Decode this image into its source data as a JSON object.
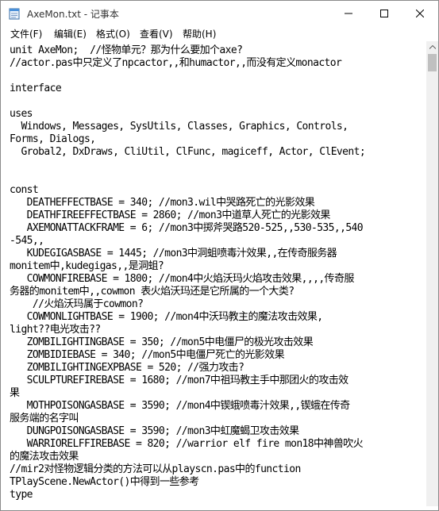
{
  "window": {
    "title": "AxeMon.txt - 记事本"
  },
  "menu": {
    "file": "文件(F)",
    "edit": "编辑(E)",
    "format": "格式(O)",
    "view": "查看(V)",
    "help": "帮助(H)"
  },
  "editor": {
    "lines": [
      "unit AxeMon;  //怪物单元？那为什么要加个axe?",
      "//actor.pas中只定义了npcactor,,和humactor,,而没有定义monactor",
      "",
      "interface",
      "",
      "uses",
      "  Windows, Messages, SysUtils, Classes, Graphics, Controls,",
      "Forms, Dialogs,",
      "  Grobal2, DxDraws, CliUtil, ClFunc, magiceff, Actor, ClEvent;",
      "",
      "",
      "const",
      "   DEATHEFFECTBASE = 340; //mon3.wil中哭路死亡的光影效果",
      "   DEATHFIREEFFECTBASE = 2860; //mon3中道草人死亡的光影效果",
      "   AXEMONATTACKFRAME = 6; //mon3中掷斧哭路520-525,,530-535,,540",
      "-545,,",
      "   KUDEGIGASBASE = 1445; //mon3中洞蛆喷毒汁效果,,在传奇服务器",
      "monitem中,kudegigas,,是洞蛆?",
      "   COWMONFIREBASE = 1800; //mon4中火焰沃玛火焰攻击效果,,,,传奇服",
      "务器的monitem中,,cowmon 表火焰沃玛还是它所属的一个大类?",
      "    //火焰沃玛属于cowmon?",
      "   COWMONLIGHTBASE = 1900; //mon4中沃玛教主的魔法攻击效果,",
      "light??电光攻击??",
      "   ZOMBILIGHTINGBASE = 350; //mon5中电僵尸的极光攻击效果",
      "   ZOMBIDIEBASE = 340; //mon5中电僵尸死亡的光影效果",
      "   ZOMBILIGHTINGEXPBASE = 520; //强力攻击?",
      "   SCULPTUREFIREBASE = 1680; //mon7中祖玛教主手中那团火的攻击效",
      "果",
      "   MOTHPOISONGASBASE = 3590; //mon4中锲蛾喷毒汁效果,,锲蛾在传奇",
      "服务端的名字叫",
      "   DUNGPOISONGASBASE = 3590; //mon3中虹魔蝎卫攻击效果",
      "   WARRIORELFFIREBASE = 820; //warrior elf fire mon18中神兽吹火",
      "的魔法攻击效果",
      "//mir2对怪物逻辑分类的方法可以从playscn.pas中的function",
      "TPlayScene.NewActor()中得到一些参考",
      "type"
    ]
  },
  "icons": {
    "app": "notepad-icon",
    "minimize": "minimize-icon",
    "maximize": "maximize-icon",
    "close": "close-icon",
    "scroll_up": "chevron-up-icon"
  }
}
